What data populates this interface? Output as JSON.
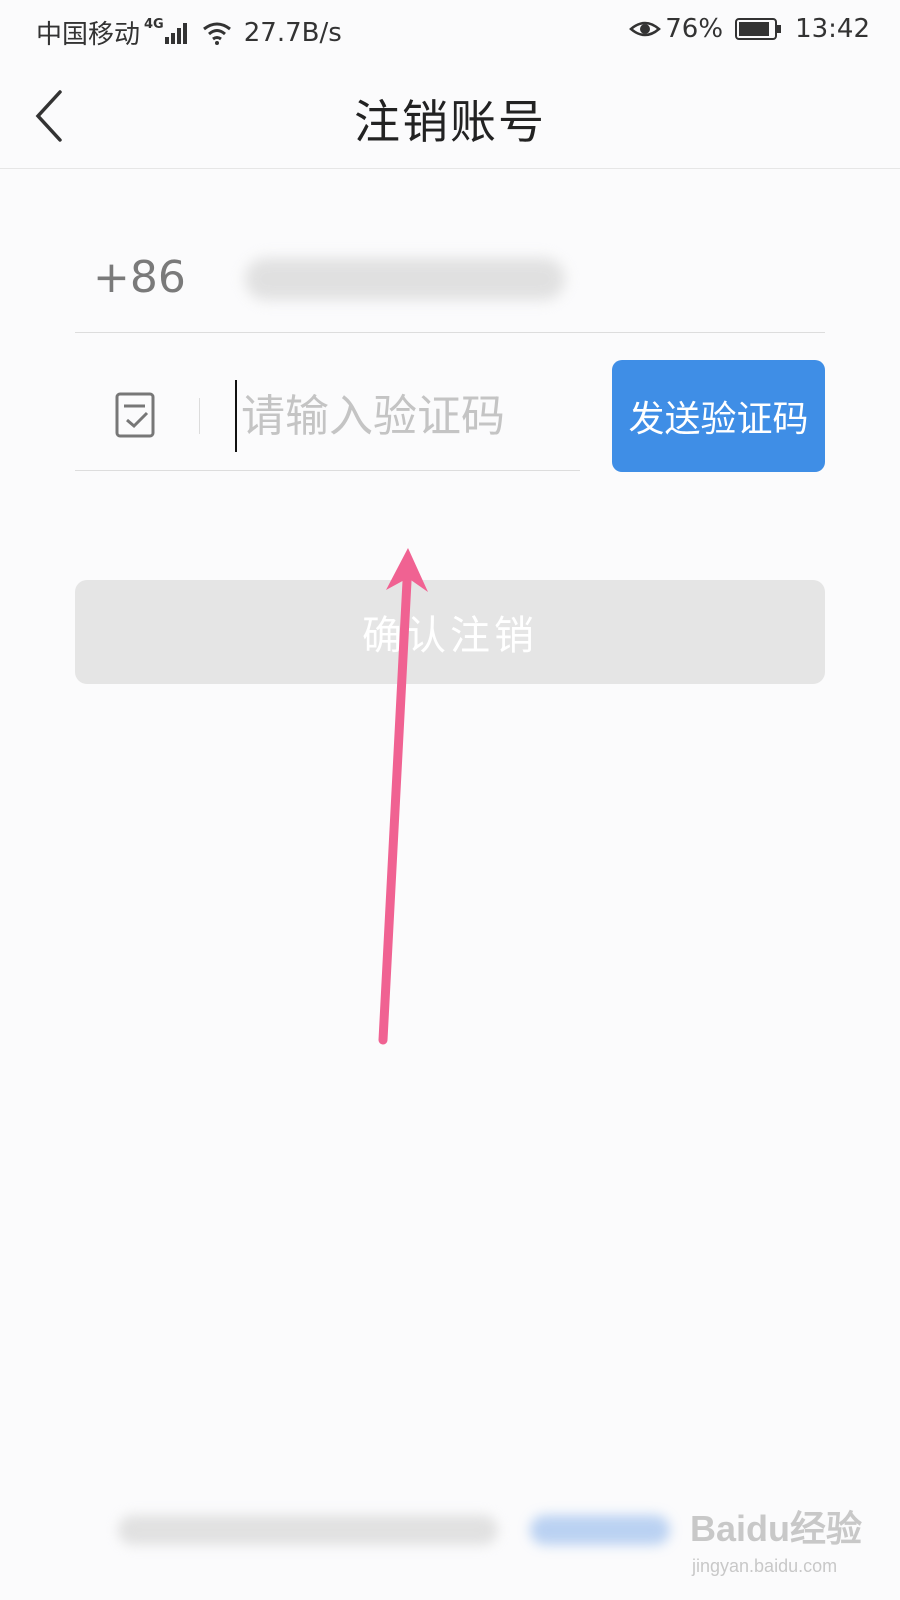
{
  "status_bar": {
    "carrier": "中国移动",
    "network_type": "4G",
    "speed": "27.7B/s",
    "battery_percent": "76%",
    "time": "13:42",
    "icons": [
      "signal-icon",
      "wifi-icon",
      "eye-icon",
      "battery-icon"
    ]
  },
  "header": {
    "title": "注销账号",
    "back_icon": "chevron-left-icon"
  },
  "form": {
    "country_code": "+86",
    "code_placeholder": "请输入验证码",
    "send_code_label": "发送验证码",
    "confirm_label": "确认注销",
    "code_icon": "checklist-icon"
  },
  "watermark": {
    "brand": "Baidu经验",
    "url": "jingyan.baidu.com"
  },
  "colors": {
    "accent": "#3f8ee6",
    "disabled_button": "#e5e5e5",
    "annotation_arrow": "#f06292"
  }
}
